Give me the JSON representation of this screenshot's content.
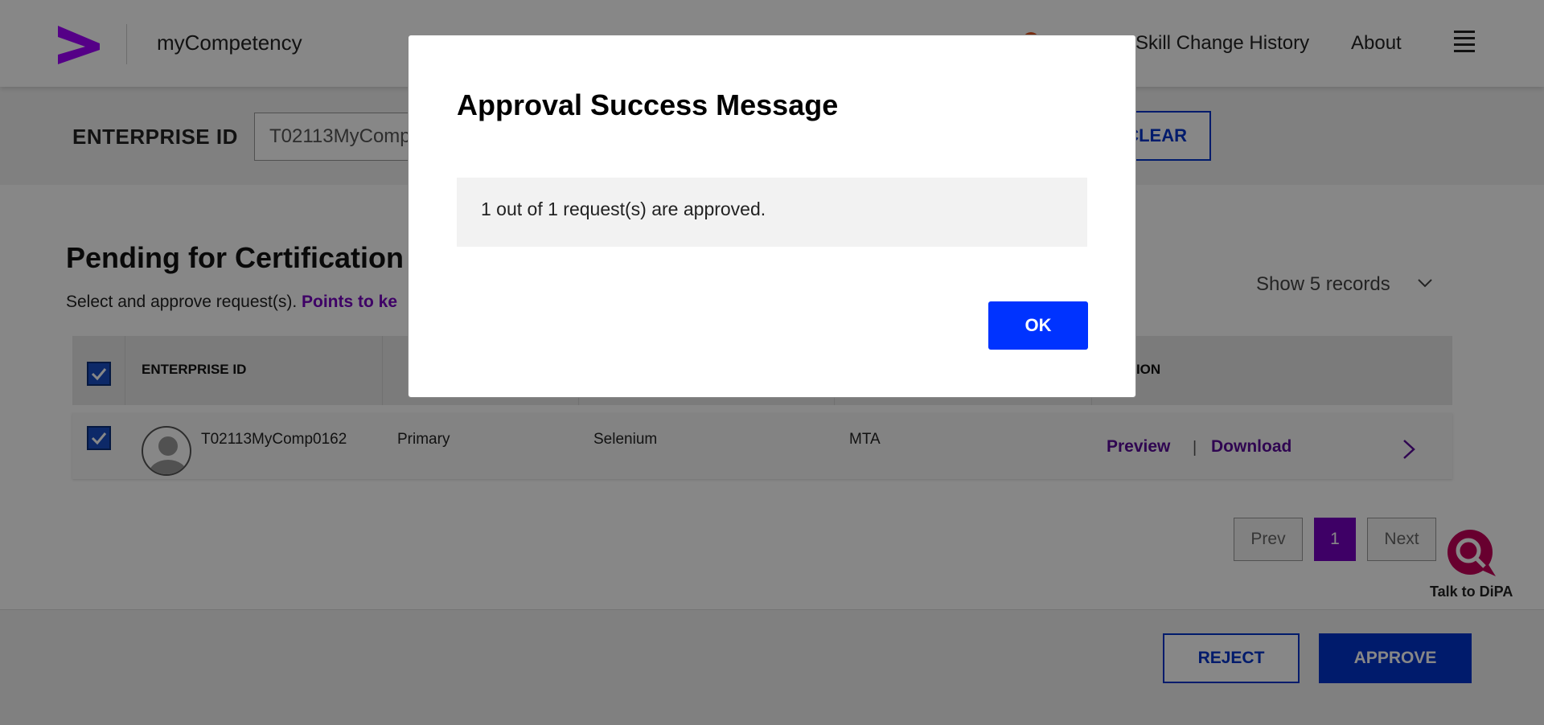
{
  "header": {
    "app_name": "myCompetency",
    "nav": {
      "skill_change_history": "Skill Change History",
      "about": "About"
    }
  },
  "search": {
    "label": "ENTERPRISE ID",
    "value": "T02113MyComp",
    "clear_label": "CLEAR"
  },
  "section": {
    "title": "Pending for Certification",
    "subtitle": "Select and approve request(s).",
    "points_link": "Points to ke",
    "show_records": "Show 5 records"
  },
  "table": {
    "header_eid": "ENTERPRISE ID",
    "header_action": "ACTION",
    "rows": [
      {
        "eid": "T02113MyComp0162",
        "type": "Primary",
        "skill": "Selenium",
        "level": "MTA",
        "preview": "Preview",
        "separator": "|",
        "download": "Download"
      }
    ]
  },
  "pagination": {
    "prev": "Prev",
    "page": "1",
    "next": "Next"
  },
  "bot": {
    "label": "Talk to DiPA"
  },
  "footer": {
    "reject": "REJECT",
    "approve": "APPROVE"
  },
  "modal": {
    "title": "Approval Success Message",
    "message": "1 out of 1 request(s) are approved.",
    "ok": "OK"
  },
  "colors": {
    "brand_purple": "#7500c0",
    "primary_blue": "#0033cc",
    "ok_blue": "#0033ff",
    "notification": "#e4551f"
  }
}
